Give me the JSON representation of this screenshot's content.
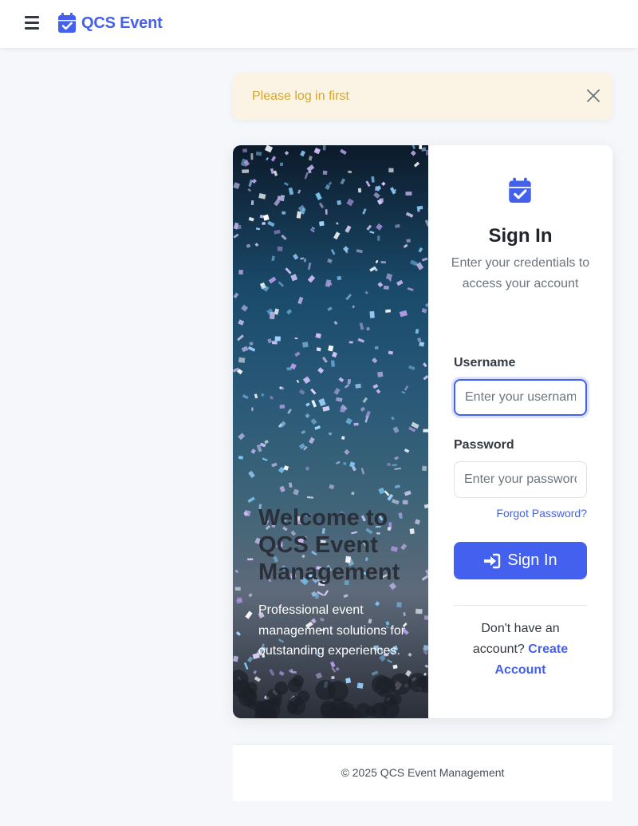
{
  "navbar": {
    "brand_text": "QCS Event",
    "brand_icon": "calendar-check-icon",
    "menu_icon": "hamburger-menu-icon",
    "brand_color": "#4361ee"
  },
  "alert": {
    "message": "Please log in first",
    "close_icon": "close-icon",
    "color": "#d4a72c",
    "background": "#fbf4e4"
  },
  "hero": {
    "title": "Welcome to QCS Event Management",
    "subtitle": "Professional event management solutions for outstanding experiences."
  },
  "login_form": {
    "icon": "calendar-check-icon",
    "title": "Sign In",
    "description": "Enter your credentials to access your account",
    "username_label": "Username",
    "username_placeholder": "Enter your username",
    "username_value": "",
    "password_label": "Password",
    "password_placeholder": "Enter your password",
    "password_value": "",
    "forgot_password": "Forgot Password?",
    "submit_label": "Sign In",
    "submit_icon": "sign-in-icon",
    "no_account_text": "Don't have an account?",
    "create_account": "Create Account"
  },
  "footer": {
    "text": "© 2025 QCS Event Management"
  }
}
